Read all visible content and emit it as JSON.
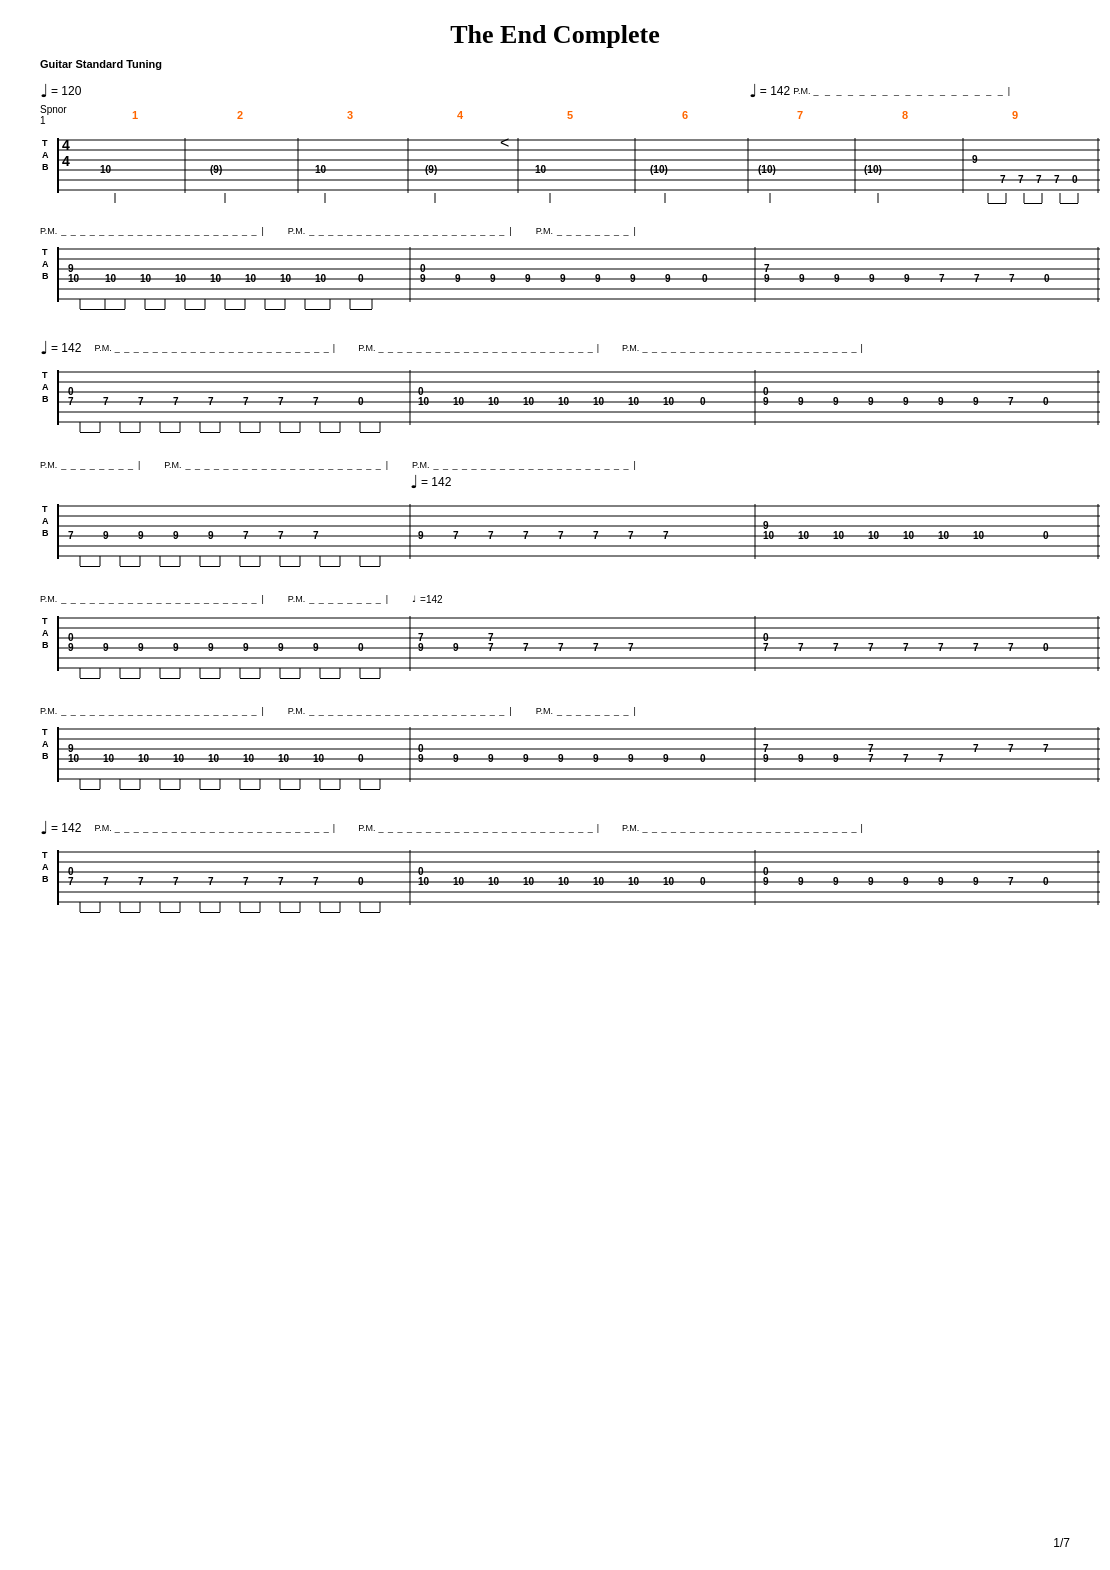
{
  "song": {
    "title": "The End Complete",
    "tuning": "Guitar Standard Tuning"
  },
  "tempos": {
    "t1": "= 120",
    "t2": "= 142"
  },
  "labels": {
    "pm": "P.M."
  },
  "pagination": {
    "current": "1/7"
  }
}
